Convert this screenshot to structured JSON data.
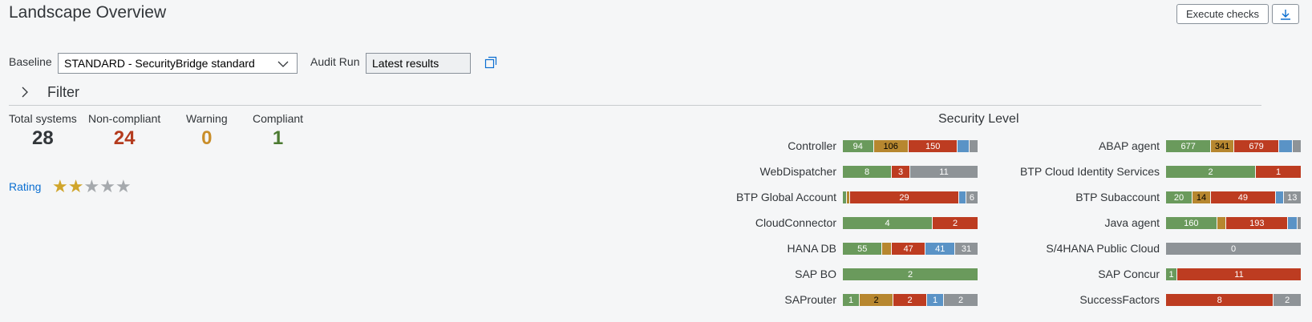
{
  "header": {
    "title": "Landscape Overview",
    "execute_label": "Execute checks",
    "download_icon": "download-icon"
  },
  "filters": {
    "baseline_label": "Baseline",
    "baseline_value": "STANDARD - SecurityBridge standard",
    "audit_label": "Audit Run",
    "audit_value": "Latest results",
    "filter_label": "Filter"
  },
  "kpis": [
    {
      "label": "Total systems",
      "value": "28",
      "color": "#32363a"
    },
    {
      "label": "Non-compliant",
      "value": "24",
      "color": "#b43b1e"
    },
    {
      "label": "Warning",
      "value": "0",
      "color": "#c98e2a"
    },
    {
      "label": "Compliant",
      "value": "1",
      "color": "#4b7a31"
    }
  ],
  "rating": {
    "label": "Rating",
    "stars_filled": 2,
    "stars_total": 5
  },
  "security_level": {
    "title": "Security Level"
  },
  "colors": {
    "green": "#6a9a5c",
    "gold": "#b7872f",
    "red": "#bd3c21",
    "blue": "#5a93c6",
    "grey": "#8e9397"
  },
  "rows_left": [
    {
      "name": "Controller",
      "segments": [
        {
          "c": "green",
          "w": 94,
          "t": "94"
        },
        {
          "c": "gold",
          "w": 106,
          "t": "106",
          "dark": true
        },
        {
          "c": "red",
          "w": 150,
          "t": "150"
        },
        {
          "c": "blue",
          "w": 36,
          "t": ""
        },
        {
          "c": "grey",
          "w": 24,
          "t": ""
        }
      ]
    },
    {
      "name": "WebDispatcher",
      "segments": [
        {
          "c": "green",
          "w": 8,
          "t": "8"
        },
        {
          "c": "red",
          "w": 3,
          "t": "3"
        },
        {
          "c": "grey",
          "w": 11,
          "t": "11"
        }
      ]
    },
    {
      "name": "BTP Global Account",
      "segments": [
        {
          "c": "green",
          "w": 1,
          "t": ""
        },
        {
          "c": "gold",
          "w": 1,
          "t": ""
        },
        {
          "c": "red",
          "w": 29,
          "t": "29"
        },
        {
          "c": "blue",
          "w": 2,
          "t": ""
        },
        {
          "c": "grey",
          "w": 3,
          "t": "6"
        }
      ]
    },
    {
      "name": "CloudConnector",
      "segments": [
        {
          "c": "green",
          "w": 4,
          "t": "4"
        },
        {
          "c": "red",
          "w": 2,
          "t": "2"
        }
      ]
    },
    {
      "name": "HANA DB",
      "segments": [
        {
          "c": "green",
          "w": 55,
          "t": "55"
        },
        {
          "c": "gold",
          "w": 13,
          "t": ""
        },
        {
          "c": "red",
          "w": 47,
          "t": "47"
        },
        {
          "c": "blue",
          "w": 41,
          "t": "41"
        },
        {
          "c": "grey",
          "w": 31,
          "t": "31"
        }
      ]
    },
    {
      "name": "SAP BO",
      "segments": [
        {
          "c": "green",
          "w": 2,
          "t": "2"
        }
      ]
    },
    {
      "name": "SAProuter",
      "segments": [
        {
          "c": "green",
          "w": 1,
          "t": "1"
        },
        {
          "c": "gold",
          "w": 2,
          "t": "2",
          "dark": true
        },
        {
          "c": "red",
          "w": 2,
          "t": "2"
        },
        {
          "c": "blue",
          "w": 1,
          "t": "1"
        },
        {
          "c": "grey",
          "w": 2,
          "t": "2"
        }
      ]
    }
  ],
  "rows_right": [
    {
      "name": "ABAP agent",
      "segments": [
        {
          "c": "green",
          "w": 677,
          "t": "677"
        },
        {
          "c": "gold",
          "w": 341,
          "t": "341",
          "dark": true
        },
        {
          "c": "red",
          "w": 679,
          "t": "679"
        },
        {
          "c": "blue",
          "w": 200,
          "t": ""
        },
        {
          "c": "grey",
          "w": 120,
          "t": ""
        }
      ]
    },
    {
      "name": "BTP Cloud Identity Services",
      "segments": [
        {
          "c": "green",
          "w": 2,
          "t": "2"
        },
        {
          "c": "red",
          "w": 1,
          "t": "1"
        }
      ]
    },
    {
      "name": "BTP Subaccount",
      "segments": [
        {
          "c": "green",
          "w": 20,
          "t": "20"
        },
        {
          "c": "gold",
          "w": 14,
          "t": "14",
          "dark": true
        },
        {
          "c": "red",
          "w": 49,
          "t": "49"
        },
        {
          "c": "blue",
          "w": 6,
          "t": ""
        },
        {
          "c": "grey",
          "w": 13,
          "t": "13"
        }
      ]
    },
    {
      "name": "Java agent",
      "segments": [
        {
          "c": "green",
          "w": 160,
          "t": "160"
        },
        {
          "c": "gold",
          "w": 30,
          "t": ""
        },
        {
          "c": "red",
          "w": 193,
          "t": "193"
        },
        {
          "c": "blue",
          "w": 30,
          "t": ""
        },
        {
          "c": "grey",
          "w": 10,
          "t": ""
        }
      ]
    },
    {
      "name": "S/4HANA Public Cloud",
      "segments": [
        {
          "c": "grey",
          "w": 1,
          "t": "0"
        }
      ]
    },
    {
      "name": "SAP Concur",
      "segments": [
        {
          "c": "green",
          "w": 1,
          "t": "1"
        },
        {
          "c": "red",
          "w": 11,
          "t": "11"
        }
      ]
    },
    {
      "name": "SuccessFactors",
      "segments": [
        {
          "c": "red",
          "w": 8,
          "t": "8"
        },
        {
          "c": "grey",
          "w": 2,
          "t": "2"
        }
      ]
    }
  ]
}
